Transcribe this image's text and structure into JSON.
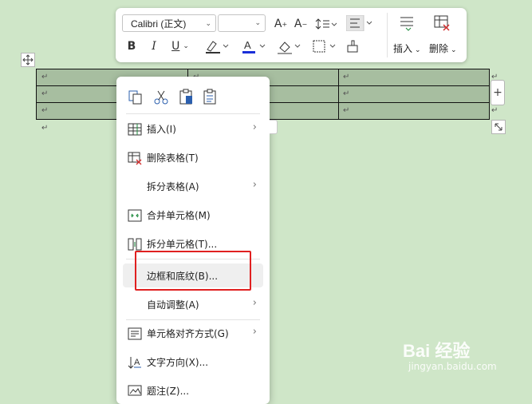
{
  "toolbar": {
    "font_name": "Calibri (正文)",
    "insert_label": "插入",
    "delete_label": "删除"
  },
  "table": {
    "cell_mark": "↵",
    "rows": 3,
    "cols": 3
  },
  "context_menu": {
    "items": [
      {
        "label": "插入(I)",
        "icon": "insert-table-icon",
        "submenu": true
      },
      {
        "label": "删除表格(T)",
        "icon": "delete-table-icon",
        "submenu": false
      },
      {
        "label": "拆分表格(A)",
        "icon": "",
        "submenu": true
      },
      {
        "label": "合并单元格(M)",
        "icon": "merge-cells-icon",
        "submenu": false
      },
      {
        "label": "拆分单元格(T)...",
        "icon": "split-cells-icon",
        "submenu": false
      },
      {
        "label": "边框和底纹(B)...",
        "icon": "",
        "submenu": false,
        "highlighted": true
      },
      {
        "label": "自动调整(A)",
        "icon": "",
        "submenu": true
      },
      {
        "label": "单元格对齐方式(G)",
        "icon": "cell-align-icon",
        "submenu": true
      },
      {
        "label": "文字方向(X)...",
        "icon": "text-direction-icon",
        "submenu": false
      },
      {
        "label": "题注(Z)...",
        "icon": "caption-icon",
        "submenu": false
      }
    ]
  },
  "watermark": {
    "brand": "Bai 经验",
    "url": "jingyan.baidu.com"
  },
  "colors": {
    "page_bg": "#cfe6c8",
    "table_fill": "#a7bea0",
    "highlight_box": "#e02020"
  }
}
